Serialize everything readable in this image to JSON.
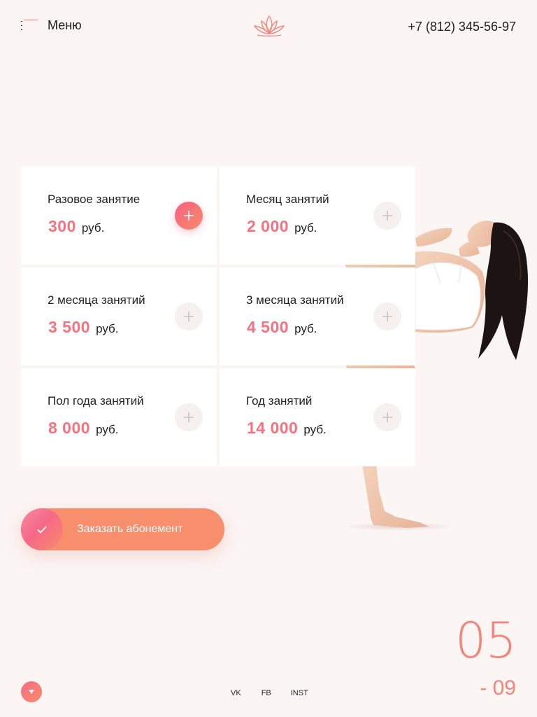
{
  "header": {
    "menu_label": "Меню",
    "phone": "+7 (812) 345-56-97"
  },
  "icons": {
    "menu": "hamburger-icon",
    "logo": "lotus-logo",
    "plus": "plus-icon",
    "check": "check-icon",
    "scroll": "arrow-down-icon"
  },
  "plans": [
    {
      "name": "Разовое занятие",
      "price": "300",
      "currency": "руб.",
      "selected": true
    },
    {
      "name": "Месяц занятий",
      "price": "2 000",
      "currency": "руб.",
      "selected": false
    },
    {
      "name": "2 месяца занятий",
      "price": "3 500",
      "currency": "руб.",
      "selected": false
    },
    {
      "name": "3 месяца занятий",
      "price": "4 500",
      "currency": "руб.",
      "selected": false
    },
    {
      "name": "Пол года занятий",
      "price": "8 000",
      "currency": "руб.",
      "selected": false
    },
    {
      "name": "Год занятий",
      "price": "14 000",
      "currency": "руб.",
      "selected": false
    }
  ],
  "order_button": {
    "label": "Заказать абонемент"
  },
  "counter": {
    "current": "05",
    "total": "- 09"
  },
  "socials": {
    "vk": "VK",
    "fb": "FB",
    "inst": "INST"
  },
  "colors": {
    "accent": "#f5727e",
    "accent_orange": "#f78e6c",
    "background": "#fbf5f4",
    "card": "#ffffff"
  }
}
